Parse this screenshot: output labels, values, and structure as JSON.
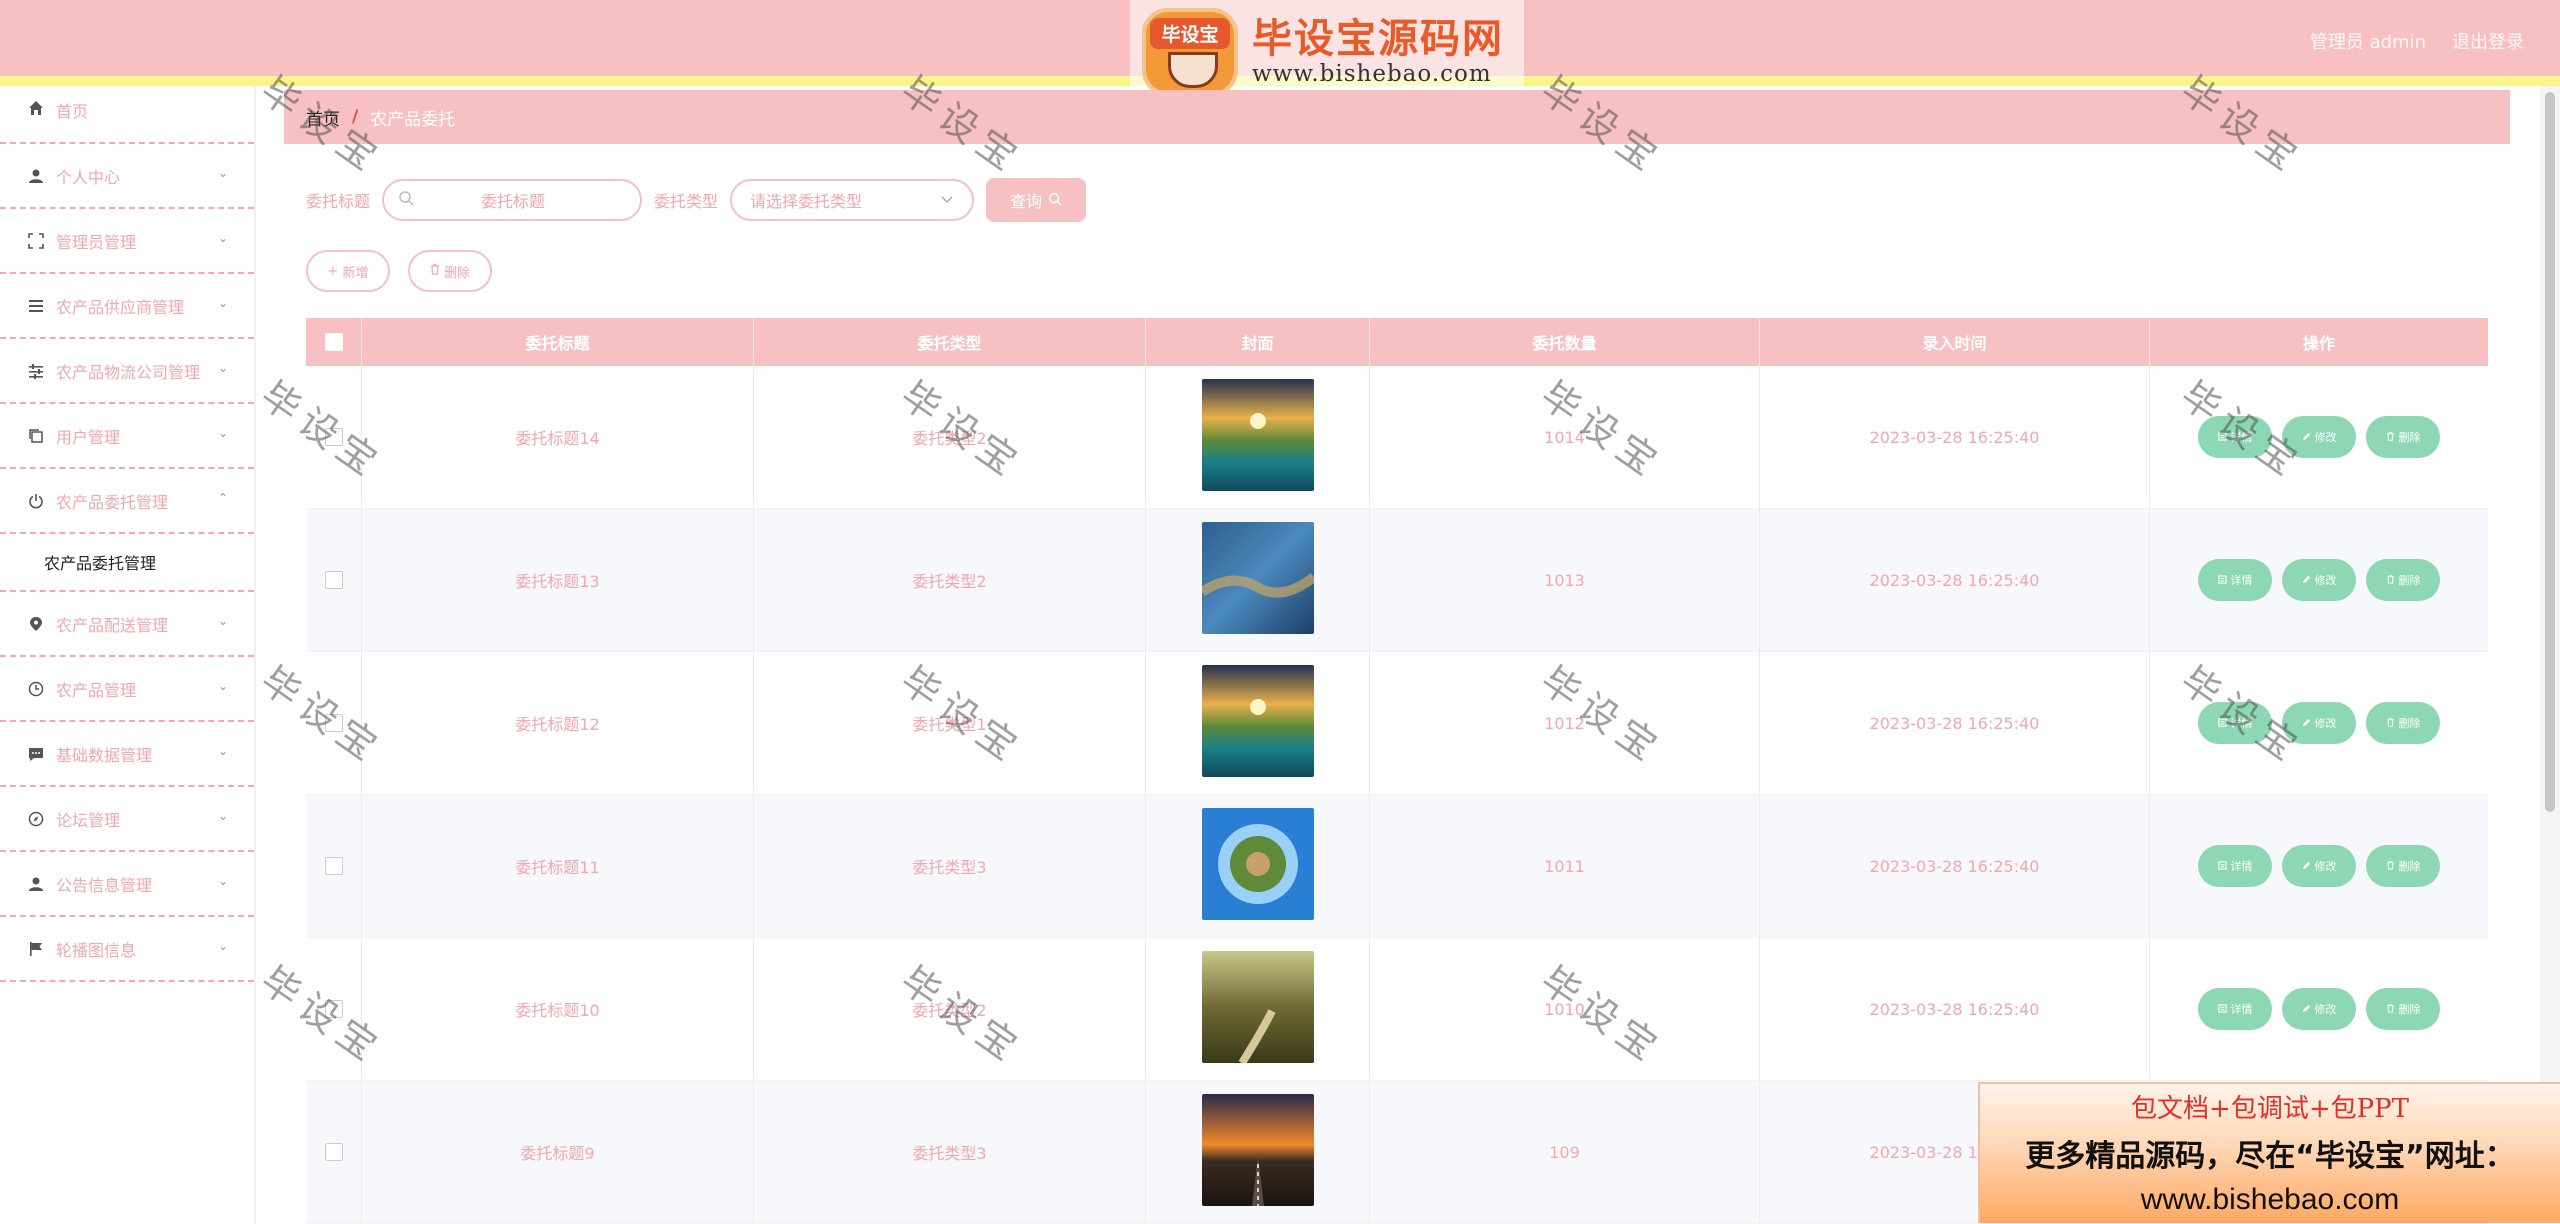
{
  "header": {
    "logo_badge": "毕设宝",
    "logo_title": "毕设宝源码网",
    "logo_url": "www.bishebao.com",
    "user_label": "管理员 admin",
    "logout_label": "退出登录"
  },
  "sidebar": {
    "items": [
      {
        "label": "首页",
        "icon": "home-icon"
      },
      {
        "label": "个人中心",
        "icon": "user-icon"
      },
      {
        "label": "管理员管理",
        "icon": "expand-icon"
      },
      {
        "label": "农产品供应商管理",
        "icon": "list-icon"
      },
      {
        "label": "农产品物流公司管理",
        "icon": "sliders-icon"
      },
      {
        "label": "用户管理",
        "icon": "copy-icon"
      },
      {
        "label": "农产品委托管理",
        "icon": "power-icon"
      },
      {
        "label": "农产品配送管理",
        "icon": "location-icon"
      },
      {
        "label": "农产品管理",
        "icon": "clock-icon"
      },
      {
        "label": "基础数据管理",
        "icon": "chat-icon"
      },
      {
        "label": "论坛管理",
        "icon": "compass-icon"
      },
      {
        "label": "公告信息管理",
        "icon": "user-icon"
      },
      {
        "label": "轮播图信息",
        "icon": "flag-icon"
      }
    ],
    "submenu_label": "农产品委托管理"
  },
  "breadcrumb": {
    "home": "首页",
    "separator": "/",
    "current": "农产品委托"
  },
  "search": {
    "title_label": "委托标题",
    "title_placeholder": "委托标题",
    "type_label": "委托类型",
    "type_placeholder": "请选择委托类型",
    "query_button": "查询"
  },
  "actions": {
    "add": "新增",
    "delete": "删除"
  },
  "table": {
    "headers": [
      "委托标题",
      "委托类型",
      "封面",
      "委托数量",
      "录入时间",
      "操作"
    ],
    "op_labels": [
      "详情",
      "修改",
      "删除"
    ],
    "rows": [
      {
        "title": "委托标题14",
        "type": "委托类型2",
        "count": "1014",
        "time": "2023-03-28 16:25:40",
        "cover": "sunset-lake"
      },
      {
        "title": "委托标题13",
        "type": "委托类型2",
        "count": "1013",
        "time": "2023-03-28 16:25:40",
        "cover": "river-aerial"
      },
      {
        "title": "委托标题12",
        "type": "委托类型1",
        "count": "1012",
        "time": "2023-03-28 16:25:40",
        "cover": "sunset-lake"
      },
      {
        "title": "委托标题11",
        "type": "委托类型3",
        "count": "1011",
        "time": "2023-03-28 16:25:40",
        "cover": "tiny-planet"
      },
      {
        "title": "委托标题10",
        "type": "委托类型2",
        "count": "1010",
        "time": "2023-03-28 16:25:40",
        "cover": "forest-path"
      },
      {
        "title": "委托标题9",
        "type": "委托类型3",
        "count": "109",
        "time": "2023-03-28 16:25:40",
        "cover": "sunset-road"
      }
    ]
  },
  "watermark": "毕设宝",
  "promo": {
    "line1": "包文档+包调试+包PPT",
    "line2": "更多精品源码，尽在“毕设宝”网址：",
    "line3": "www.bishebao.com"
  },
  "colors": {
    "primary_pink": "#f7c1c4",
    "text_pink": "#f4a7ae",
    "accent_yellow": "#f8f58a",
    "op_green": "#8dd7b4"
  }
}
